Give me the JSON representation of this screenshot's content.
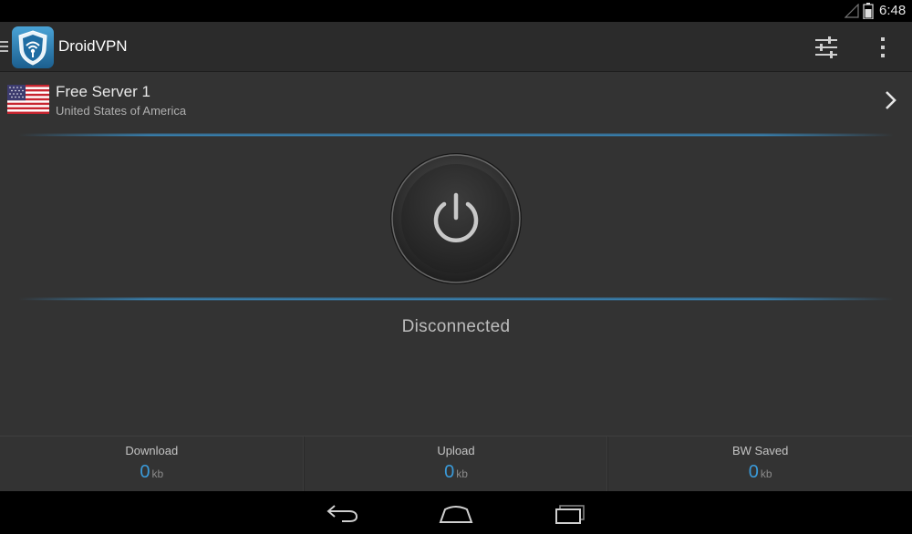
{
  "status_bar": {
    "time": "6:48",
    "signal_icon": "signal-icon",
    "battery_icon": "battery-icon"
  },
  "action_bar": {
    "title": "DroidVPN",
    "logo_icon": "droidvpn-shield-logo",
    "settings_icon": "sliders-icon",
    "overflow_icon": "overflow-menu-icon"
  },
  "server": {
    "name": "Free Server 1",
    "country": "United States of America",
    "flag_icon": "us-flag-icon"
  },
  "connection": {
    "status": "Disconnected",
    "power_icon": "power-icon"
  },
  "stats": [
    {
      "label": "Download",
      "value": "0",
      "unit": "kb"
    },
    {
      "label": "Upload",
      "value": "0",
      "unit": "kb"
    },
    {
      "label": "BW Saved",
      "value": "0",
      "unit": "kb"
    }
  ],
  "nav_bar": {
    "back_icon": "back-icon",
    "home_icon": "home-icon",
    "recents_icon": "recents-icon"
  },
  "colors": {
    "accent": "#3a9ad9",
    "background": "#333333",
    "action_bar": "#2b2b2b"
  }
}
